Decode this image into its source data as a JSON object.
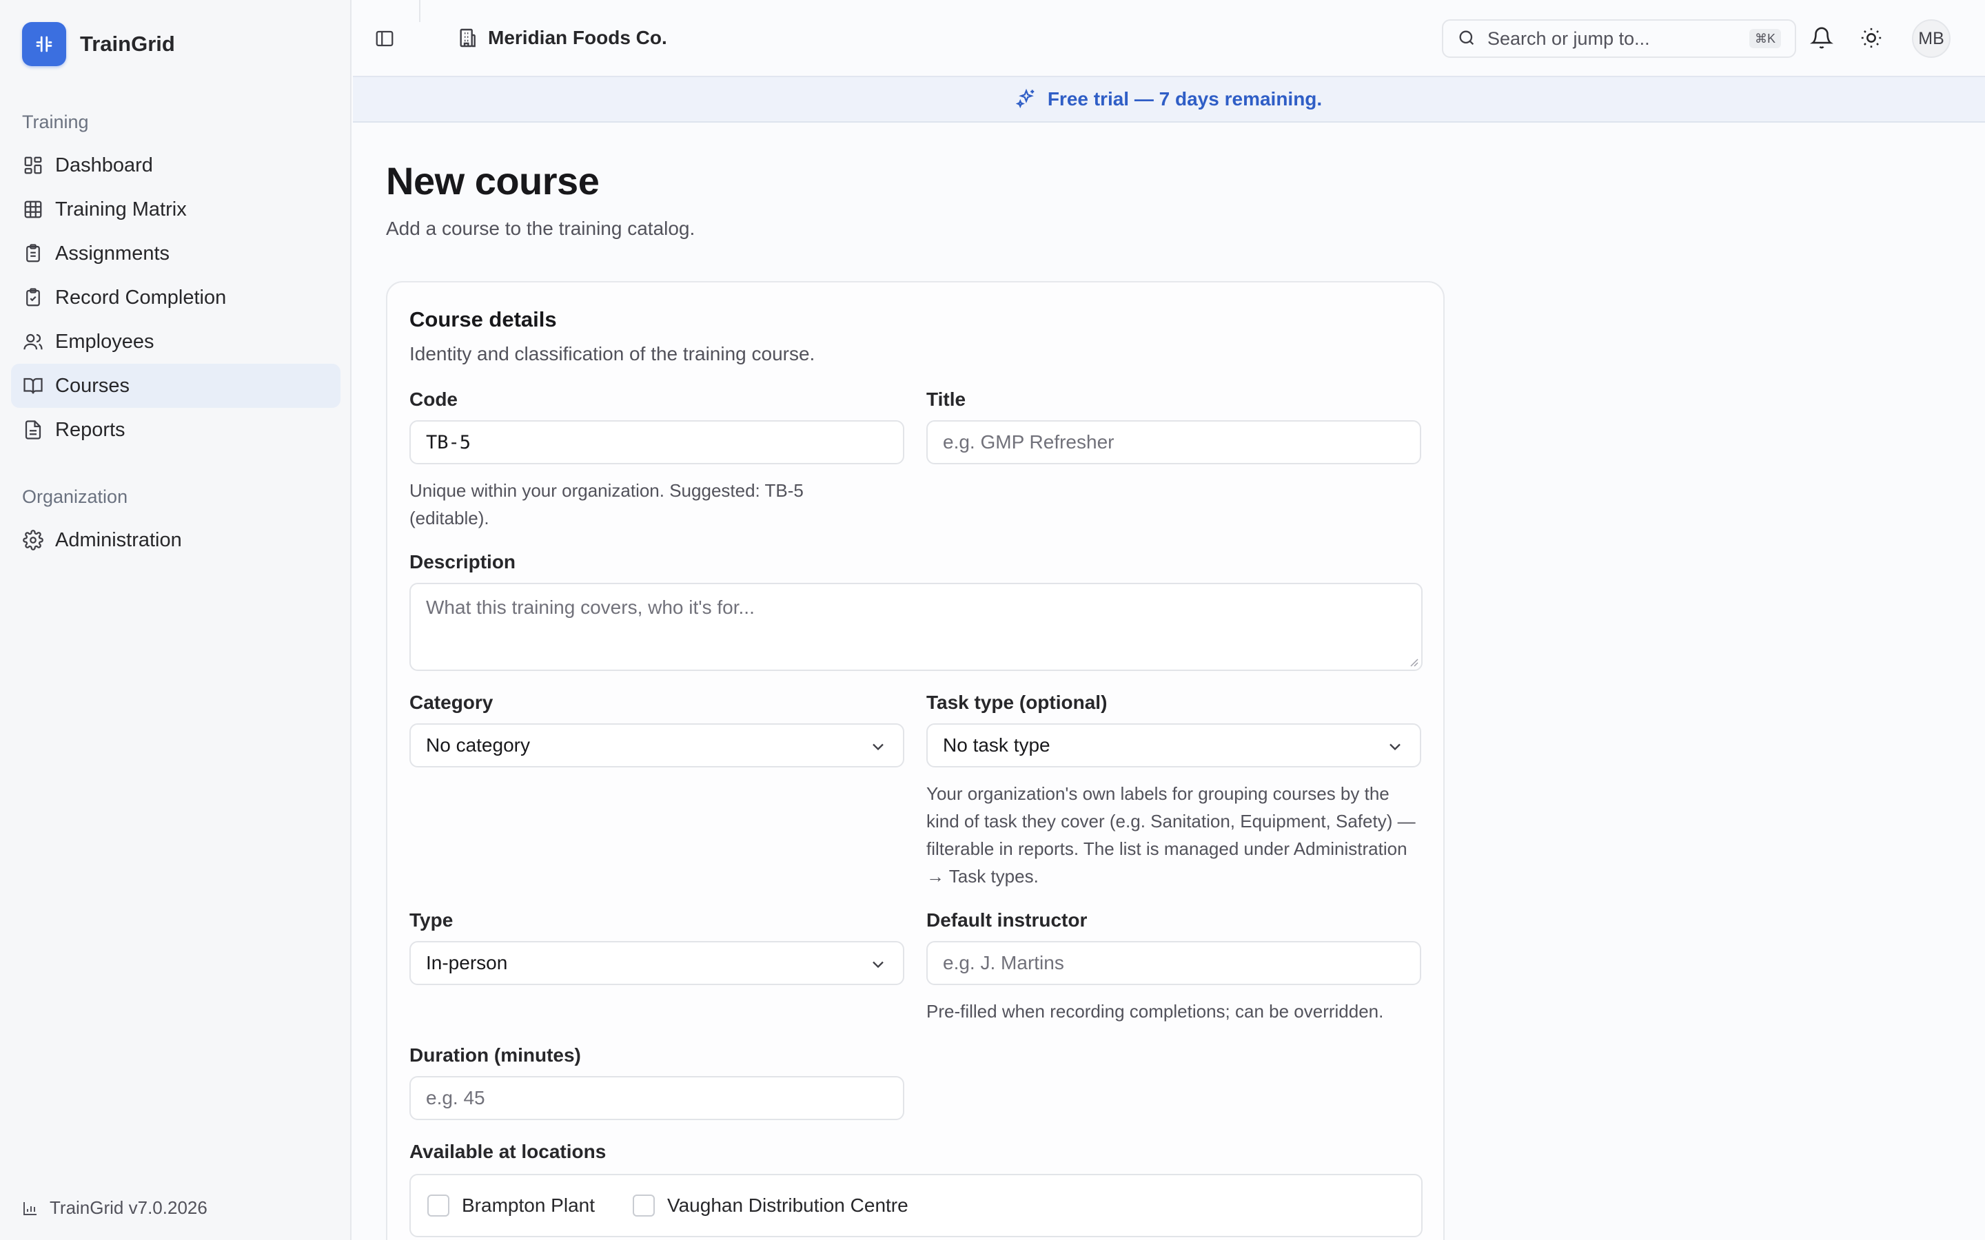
{
  "app": {
    "name": "TrainGrid",
    "version": "TrainGrid v7.0.2026"
  },
  "sidebar": {
    "groups": [
      {
        "label": "Training",
        "items": [
          {
            "label": "Dashboard",
            "icon": "dashboard-icon",
            "active": false
          },
          {
            "label": "Training Matrix",
            "icon": "grid-icon",
            "active": false
          },
          {
            "label": "Assignments",
            "icon": "clipboard-icon",
            "active": false
          },
          {
            "label": "Record Completion",
            "icon": "clipboard-check-icon",
            "active": false
          },
          {
            "label": "Employees",
            "icon": "users-icon",
            "active": false
          },
          {
            "label": "Courses",
            "icon": "book-icon",
            "active": true
          },
          {
            "label": "Reports",
            "icon": "file-icon",
            "active": false
          }
        ]
      },
      {
        "label": "Organization",
        "items": [
          {
            "label": "Administration",
            "icon": "gear-icon",
            "active": false
          }
        ]
      }
    ]
  },
  "header": {
    "org_name": "Meridian Foods Co.",
    "search_placeholder": "Search or jump to...",
    "search_shortcut": "⌘K",
    "avatar_initials": "MB"
  },
  "banner": {
    "text": "Free trial — 7 days remaining."
  },
  "page": {
    "title": "New course",
    "subtitle": "Add a course to the training catalog."
  },
  "form": {
    "section_title": "Course details",
    "section_desc": "Identity and classification of the training course.",
    "code": {
      "label": "Code",
      "value": "TB-5",
      "help": "Unique within your organization. Suggested: TB-5 (editable)."
    },
    "title": {
      "label": "Title",
      "placeholder": "e.g. GMP Refresher"
    },
    "description": {
      "label": "Description",
      "placeholder": "What this training covers, who it's for..."
    },
    "category": {
      "label": "Category",
      "value": "No category"
    },
    "task_type": {
      "label": "Task type (optional)",
      "value": "No task type",
      "help": "Your organization's own labels for grouping courses by the kind of task they cover (e.g. Sanitation, Equipment, Safety) — filterable in reports. The list is managed under Administration → Task types."
    },
    "type": {
      "label": "Type",
      "value": "In-person"
    },
    "instructor": {
      "label": "Default instructor",
      "placeholder": "e.g. J. Martins",
      "help": "Pre-filled when recording completions; can be overridden."
    },
    "duration": {
      "label": "Duration (minutes)",
      "placeholder": "e.g. 45"
    },
    "locations": {
      "label": "Available at locations",
      "options": [
        {
          "label": "Brampton Plant",
          "checked": false
        },
        {
          "label": "Vaughan Distribution Centre",
          "checked": false
        }
      ]
    }
  },
  "colors": {
    "accent": "#3b6fe0",
    "banner_text": "#2f5ec6",
    "active_nav": "#e8eef8"
  }
}
